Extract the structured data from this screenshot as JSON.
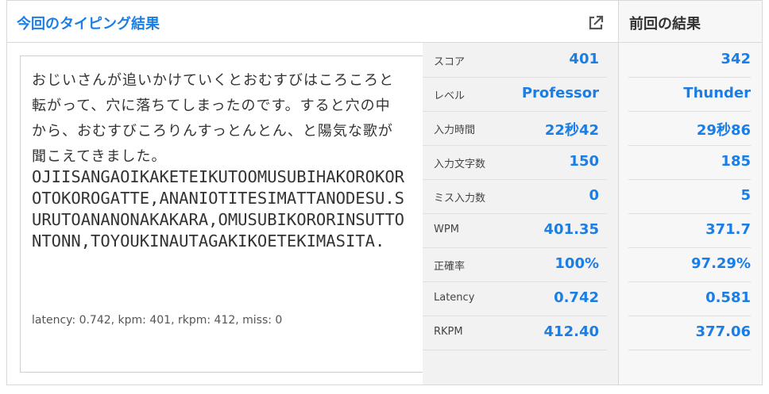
{
  "header": {
    "current_title": "今回のタイピング結果",
    "previous_title": "前回の結果"
  },
  "typing": {
    "japanese": "おじいさんが追いかけていくとおむすびはころころと転がって、穴に落ちてしまったのです。すると穴の中から、おむすびころりんすっとんとん、と陽気な歌が聞こえてきました。",
    "romaji": "OJIISANGAOIKAKETEIKUTOOMUSUBIHAKOROKOROTOKOROGATTE,ANANIOTITESIMATTANODESU.SURUTOANANONAKAKARA,OMUSUBIKORORINSUTTONTONN,TOYOUKINAUTAGAKIKOETEKIMASITA.",
    "stats_line": "latency: 0.742, kpm: 401, rkpm: 412, miss: 0"
  },
  "results": [
    {
      "label": "スコア",
      "current": "401",
      "previous": "342"
    },
    {
      "label": "レベル",
      "current": "Professor",
      "previous": "Thunder"
    },
    {
      "label": "入力時間",
      "current": "22秒42",
      "previous": "29秒86"
    },
    {
      "label": "入力文字数",
      "current": "150",
      "previous": "185"
    },
    {
      "label": "ミス入力数",
      "current": "0",
      "previous": "5"
    },
    {
      "label": "WPM",
      "current": "401.35",
      "previous": "371.7"
    },
    {
      "label": "正確率",
      "current": "100%",
      "previous": "97.29%"
    },
    {
      "label": "Latency",
      "current": "0.742",
      "previous": "0.581"
    },
    {
      "label": "RKPM",
      "current": "412.40",
      "previous": "377.06"
    }
  ],
  "icons": {
    "external_link": "external-link-icon"
  },
  "colors": {
    "accent": "#1a7ee6"
  }
}
